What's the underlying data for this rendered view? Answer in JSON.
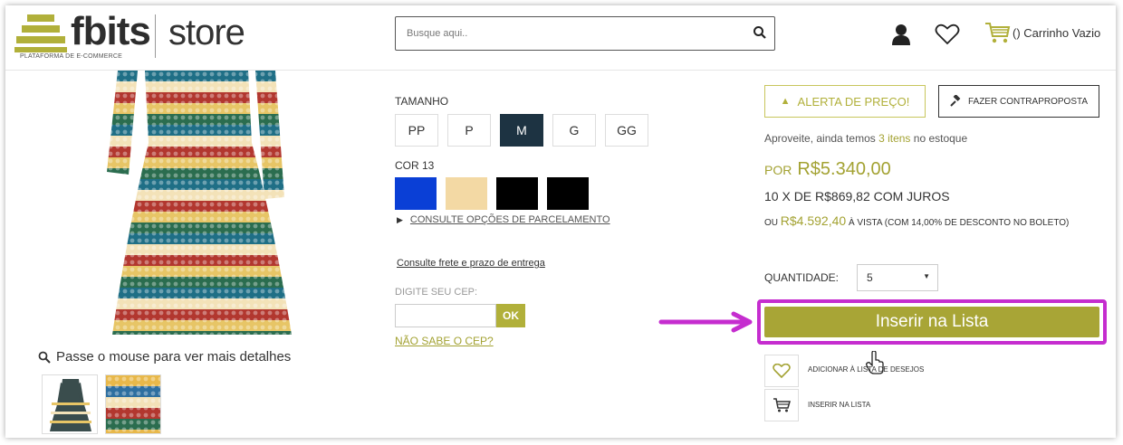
{
  "brand": {
    "name": "fbits",
    "tagline": "PLATAFORMA DE E-COMMERCE",
    "store": "store",
    "accent": "#b1b03a"
  },
  "header": {
    "search_placeholder": "Busque aqui..",
    "cart_label": "() Carrinho Vazio"
  },
  "gallery": {
    "zoom_hint": "Passe o mouse para ver mais detalhes"
  },
  "product": {
    "size_label": "TAMANHO",
    "sizes": [
      "PP",
      "P",
      "M",
      "G",
      "GG"
    ],
    "selected_size": "M",
    "color_label": "COR 13",
    "colors": [
      "#0a3fd6",
      "#f3d9a4",
      "#000000",
      "#000000"
    ],
    "installments_link": "CONSULTE OPÇÕES DE PARCELAMENTO",
    "freight_link": "Consulte frete e prazo de entrega",
    "cep_label": "DIGITE SEU CEP:",
    "cep_ok": "OK",
    "cep_unknown": "NÃO SABE O CEP?"
  },
  "purchase": {
    "price_alert": "ALERTA DE PREÇO!",
    "counter_offer": "FAZER CONTRAPROPOSTA",
    "stock_pre": "Aproveite, ainda temos ",
    "stock_count": "3 itens",
    "stock_post": " no estoque",
    "price_prefix": "POR",
    "price": "R$5.340,00",
    "installments": "10 X DE R$869,82 COM JUROS",
    "cash_prefix": "OU",
    "cash_price": "R$4.592,40",
    "cash_suffix": "À VISTA (COM 14,00% DE DESCONTO NO BOLETO)",
    "quantity_label": "QUANTIDADE:",
    "quantity": "5",
    "insert_button": "Inserir na Lista",
    "wishlist_label": "ADICIONAR À LISTA DE DESEJOS",
    "list_label": "INSERIR NA LISTA",
    "highlight_color": "#c52dcf"
  }
}
